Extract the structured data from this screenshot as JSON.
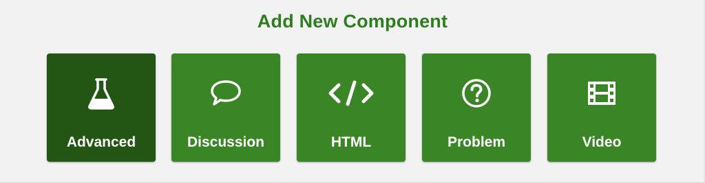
{
  "header": {
    "title": "Add New Component"
  },
  "colors": {
    "title": "#2e7d1f",
    "button": "#3a8526",
    "button_active": "#235614",
    "background": "#f2f2f2"
  },
  "components": [
    {
      "label": "Advanced",
      "icon": "flask-icon",
      "selected": true
    },
    {
      "label": "Discussion",
      "icon": "speech-bubble-icon",
      "selected": false
    },
    {
      "label": "HTML",
      "icon": "code-icon",
      "selected": false
    },
    {
      "label": "Problem",
      "icon": "question-circle-icon",
      "selected": false
    },
    {
      "label": "Video",
      "icon": "film-icon",
      "selected": false
    }
  ]
}
